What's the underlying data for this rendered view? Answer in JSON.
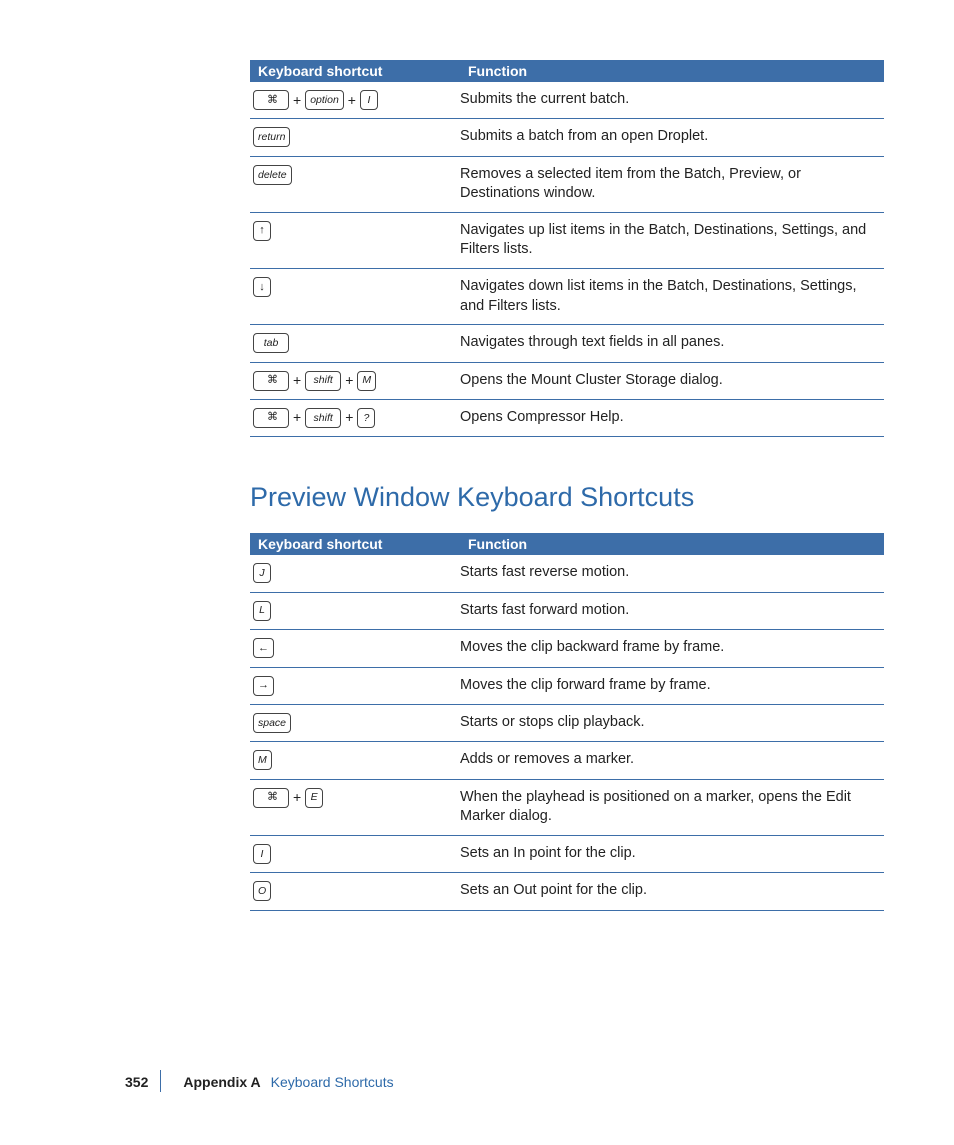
{
  "table1": {
    "headers": {
      "col1": "Keyboard shortcut",
      "col2": "Function"
    },
    "rows": [
      {
        "keys": [
          {
            "t": "cmd"
          },
          {
            "t": "plus"
          },
          {
            "t": "key",
            "v": "option",
            "w": true
          },
          {
            "t": "plus"
          },
          {
            "t": "key",
            "v": "I"
          }
        ],
        "fn": "Submits the current batch."
      },
      {
        "keys": [
          {
            "t": "key",
            "v": "return",
            "w": true
          }
        ],
        "fn": "Submits a batch from an open Droplet."
      },
      {
        "keys": [
          {
            "t": "key",
            "v": "delete",
            "w": true
          }
        ],
        "fn": "Removes a selected item from the Batch, Preview, or Destinations window."
      },
      {
        "keys": [
          {
            "t": "sym",
            "v": "↑"
          }
        ],
        "fn": "Navigates up list items in the Batch, Destinations, Settings, and Filters lists."
      },
      {
        "keys": [
          {
            "t": "sym",
            "v": "↓"
          }
        ],
        "fn": "Navigates down list items in the Batch, Destinations, Settings, and Filters lists."
      },
      {
        "keys": [
          {
            "t": "key",
            "v": "tab",
            "w": true
          }
        ],
        "fn": "Navigates through text fields in all panes."
      },
      {
        "keys": [
          {
            "t": "cmd"
          },
          {
            "t": "plus"
          },
          {
            "t": "key",
            "v": "shift",
            "w": true
          },
          {
            "t": "plus"
          },
          {
            "t": "key",
            "v": "M"
          }
        ],
        "fn": "Opens the Mount Cluster Storage dialog."
      },
      {
        "keys": [
          {
            "t": "cmd"
          },
          {
            "t": "plus"
          },
          {
            "t": "key",
            "v": "shift",
            "w": true
          },
          {
            "t": "plus"
          },
          {
            "t": "key",
            "v": "?"
          }
        ],
        "fn": "Opens Compressor Help."
      }
    ]
  },
  "section_heading": "Preview Window Keyboard Shortcuts",
  "table2": {
    "headers": {
      "col1": "Keyboard shortcut",
      "col2": "Function"
    },
    "rows": [
      {
        "keys": [
          {
            "t": "key",
            "v": "J"
          }
        ],
        "fn": "Starts fast reverse motion."
      },
      {
        "keys": [
          {
            "t": "key",
            "v": "L"
          }
        ],
        "fn": "Starts fast forward motion."
      },
      {
        "keys": [
          {
            "t": "sym",
            "v": "←"
          }
        ],
        "fn": "Moves the clip backward frame by frame."
      },
      {
        "keys": [
          {
            "t": "sym",
            "v": "→"
          }
        ],
        "fn": "Moves the clip forward frame by frame."
      },
      {
        "keys": [
          {
            "t": "key",
            "v": "space",
            "w": true
          }
        ],
        "fn": "Starts or stops clip playback."
      },
      {
        "keys": [
          {
            "t": "key",
            "v": "M"
          }
        ],
        "fn": "Adds or removes a marker."
      },
      {
        "keys": [
          {
            "t": "cmd"
          },
          {
            "t": "plus"
          },
          {
            "t": "key",
            "v": "E"
          }
        ],
        "fn": "When the playhead is positioned on a marker, opens the Edit Marker dialog."
      },
      {
        "keys": [
          {
            "t": "key",
            "v": "I"
          }
        ],
        "fn": "Sets an In point for the clip."
      },
      {
        "keys": [
          {
            "t": "key",
            "v": "O"
          }
        ],
        "fn": "Sets an Out point for the clip."
      }
    ]
  },
  "footer": {
    "page": "352",
    "appendix": "Appendix A",
    "title": "Keyboard Shortcuts"
  }
}
